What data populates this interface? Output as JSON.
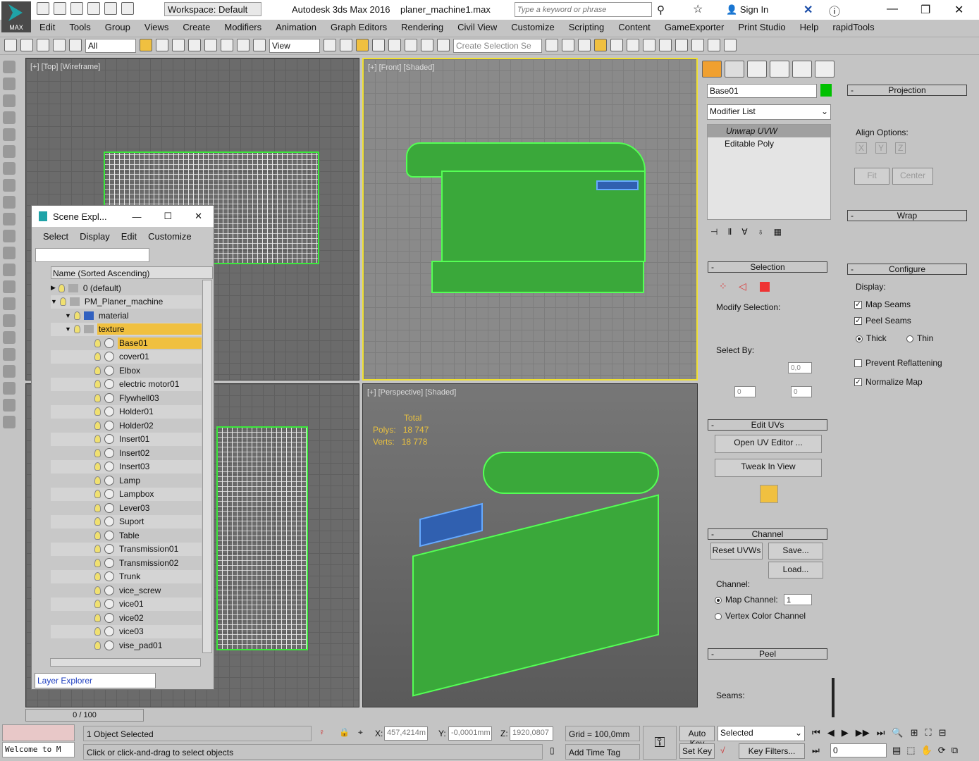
{
  "app": {
    "logo": "MAX",
    "workspace": "Workspace: Default",
    "title": "Autodesk 3ds Max 2016",
    "file": "planer_machine1.max",
    "search_placeholder": "Type a keyword or phrase",
    "sign_in": "Sign In",
    "accent": "#1fa3a8"
  },
  "menu": [
    "Edit",
    "Tools",
    "Group",
    "Views",
    "Create",
    "Modifiers",
    "Animation",
    "Graph Editors",
    "Rendering",
    "Civil View",
    "Customize",
    "Scripting",
    "Content",
    "GameExporter",
    "Print Studio",
    "Help",
    "rapidTools"
  ],
  "toolbar": {
    "filter": "All",
    "ref_coord": "View",
    "selection_set_placeholder": "Create Selection Se"
  },
  "viewports": {
    "top": "[+] [Top] [Wireframe]",
    "front": "[+] [Front] [Shaded]",
    "perspective": "[+] [Perspective] [Shaded]",
    "stats": {
      "total": "Total",
      "polys_label": "Polys:",
      "polys": "18 747",
      "verts_label": "Verts:",
      "verts": "18 778"
    }
  },
  "scene_explorer": {
    "title": "Scene Expl...",
    "menu": [
      "Select",
      "Display",
      "Edit",
      "Customize"
    ],
    "column": "Name (Sorted Ascending)",
    "footer": "Layer Explorer",
    "rows": [
      {
        "name": "0 (default)",
        "level": 0,
        "type": "layer"
      },
      {
        "name": "PM_Planer_machine",
        "level": 0,
        "type": "layer"
      },
      {
        "name": "material",
        "level": 1,
        "type": "layer"
      },
      {
        "name": "texture",
        "level": 1,
        "type": "layer",
        "selected": true
      },
      {
        "name": "Base01",
        "level": 2,
        "selected": true
      },
      {
        "name": "cover01",
        "level": 2
      },
      {
        "name": "Elbox",
        "level": 2
      },
      {
        "name": "electric motor01",
        "level": 2
      },
      {
        "name": "Flywhell03",
        "level": 2
      },
      {
        "name": "Holder01",
        "level": 2
      },
      {
        "name": "Holder02",
        "level": 2
      },
      {
        "name": "Insert01",
        "level": 2
      },
      {
        "name": "Insert02",
        "level": 2
      },
      {
        "name": "Insert03",
        "level": 2
      },
      {
        "name": "Lamp",
        "level": 2
      },
      {
        "name": "Lampbox",
        "level": 2
      },
      {
        "name": "Lever03",
        "level": 2
      },
      {
        "name": "Suport",
        "level": 2
      },
      {
        "name": "Table",
        "level": 2
      },
      {
        "name": "Transmission01",
        "level": 2
      },
      {
        "name": "Transmission02",
        "level": 2
      },
      {
        "name": "Trunk",
        "level": 2
      },
      {
        "name": "vice_screw",
        "level": 2
      },
      {
        "name": "vice01",
        "level": 2
      },
      {
        "name": "vice02",
        "level": 2
      },
      {
        "name": "vice03",
        "level": 2
      },
      {
        "name": "vise_pad01",
        "level": 2
      }
    ]
  },
  "modify": {
    "object_name": "Base01",
    "object_color": "#00c000",
    "modifier_list": "Modifier List",
    "stack": [
      "Unwrap UVW",
      "Editable Poly"
    ],
    "selection": {
      "title": "Selection",
      "modify_selection": "Modify Selection:",
      "select_by": "Select By:",
      "angle": "0,0",
      "v1": "0",
      "v2": "0"
    },
    "edit_uvs": {
      "title": "Edit UVs",
      "open": "Open UV Editor ...",
      "tweak": "Tweak In View"
    },
    "channel": {
      "title": "Channel",
      "reset": "Reset UVWs",
      "save": "Save...",
      "load": "Load...",
      "label": "Channel:",
      "map_channel": "Map Channel:",
      "map_channel_value": "1",
      "vertex_color": "Vertex Color Channel"
    },
    "peel": {
      "title": "Peel",
      "seams": "Seams:"
    },
    "projection": {
      "title": "Projection",
      "align": "Align Options:",
      "fit": "Fit",
      "center": "Center",
      "axes": [
        "X",
        "Y",
        "Z"
      ]
    },
    "wrap": {
      "title": "Wrap"
    },
    "configure": {
      "title": "Configure",
      "display": "Display:",
      "map_seams": "Map Seams",
      "peel_seams": "Peel Seams",
      "thick": "Thick",
      "thin": "Thin",
      "prevent": "Prevent Reflattening",
      "normalize": "Normalize Map",
      "map_seams_checked": true,
      "peel_seams_checked": true,
      "prevent_checked": false,
      "normalize_checked": true
    }
  },
  "timeline": {
    "frame": "0 / 100"
  },
  "status": {
    "selected": "1 Object Selected",
    "prompt": "Click or click-and-drag to select objects",
    "x_label": "X:",
    "x": "457,4214m",
    "y_label": "Y:",
    "y": "-0,0001mm",
    "z_label": "Z:",
    "z": "1920,0807",
    "grid": "Grid = 100,0mm",
    "add_time_tag": "Add Time Tag",
    "auto_key": "Auto Key",
    "set_key": "Set Key",
    "key_mode": "Selected",
    "key_filters": "Key Filters...",
    "current_frame": "0",
    "maxscript": "Welcome to M"
  }
}
